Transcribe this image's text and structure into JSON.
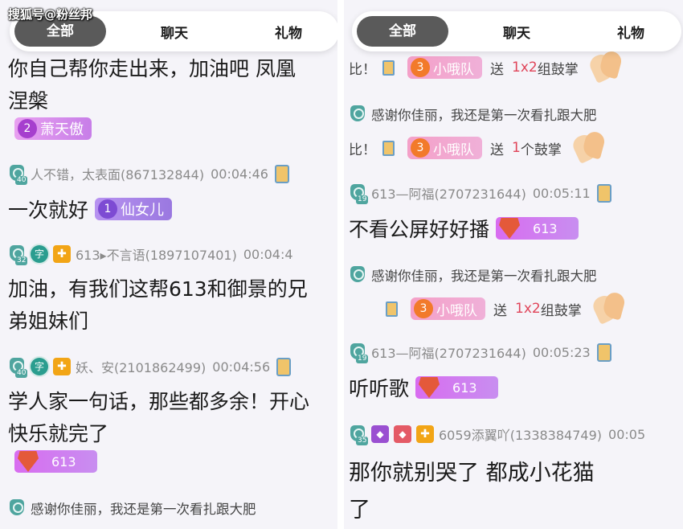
{
  "watermark": "搜狐号@粉丝邦",
  "tabs": [
    "全部",
    "聊天",
    "礼物"
  ],
  "left": {
    "line1": "你自己帮你走出来，加油吧  凤凰",
    "line2": "涅槃",
    "fan1": {
      "level": "2",
      "name": "萧天傲"
    },
    "msg2": {
      "user": "人不错，太表面(867132844)",
      "time": "00:04:46",
      "level": "40",
      "text": "一次就好",
      "fan_level": "1",
      "fan_name": "仙女儿"
    },
    "msg3": {
      "user": "613▸不言语(1897107401)",
      "time": "00:04:4",
      "level": "32",
      "badge": "字",
      "text1": "加油，有我们这帮613和御景的兄",
      "text2": "弟姐妹们"
    },
    "msg4": {
      "user": "妖、安(2101862499)",
      "time": "00:04:56",
      "level": "40",
      "badge": "字",
      "text1": "学人家一句话，那些都多余！开心",
      "text2": "快乐就完了",
      "fan_level": "2",
      "fan_name": "613"
    },
    "thanks": "感谢你佳丽，我还是第一次看扎跟大肥"
  },
  "right": {
    "gift1": {
      "prefix": "比！",
      "fan_level": "3",
      "fan_name": "小哦队",
      "send": "送",
      "count": "1x2",
      "gift": "组鼓掌"
    },
    "thanks1": "感谢你佳丽，我还是第一次看扎跟大肥",
    "gift2": {
      "prefix": "比！",
      "fan_level": "3",
      "fan_name": "小哦队",
      "send": "送",
      "count": "1",
      "gift": "个鼓掌"
    },
    "msg1": {
      "user": "613—阿福(2707231644)",
      "time": "00:05:11",
      "level": "19",
      "text": "不看公屏好好播",
      "fan_level": "1",
      "fan_name": "613"
    },
    "thanks2": "感谢你佳丽，我还是第一次看扎跟大肥",
    "gift3": {
      "fan_level": "3",
      "fan_name": "小哦队",
      "send": "送",
      "count": "1x2",
      "gift": "组鼓掌"
    },
    "msg2": {
      "user": "613—阿福(2707231644)",
      "time": "00:05:23",
      "level": "19",
      "text": "听听歌",
      "fan_level": "1",
      "fan_name": "613"
    },
    "msg3": {
      "user": "6059添翼吖(1338384749)",
      "time": "00:05",
      "level": "35",
      "text1": "那你就别哭了  都成小花猫",
      "text2": "了"
    }
  }
}
